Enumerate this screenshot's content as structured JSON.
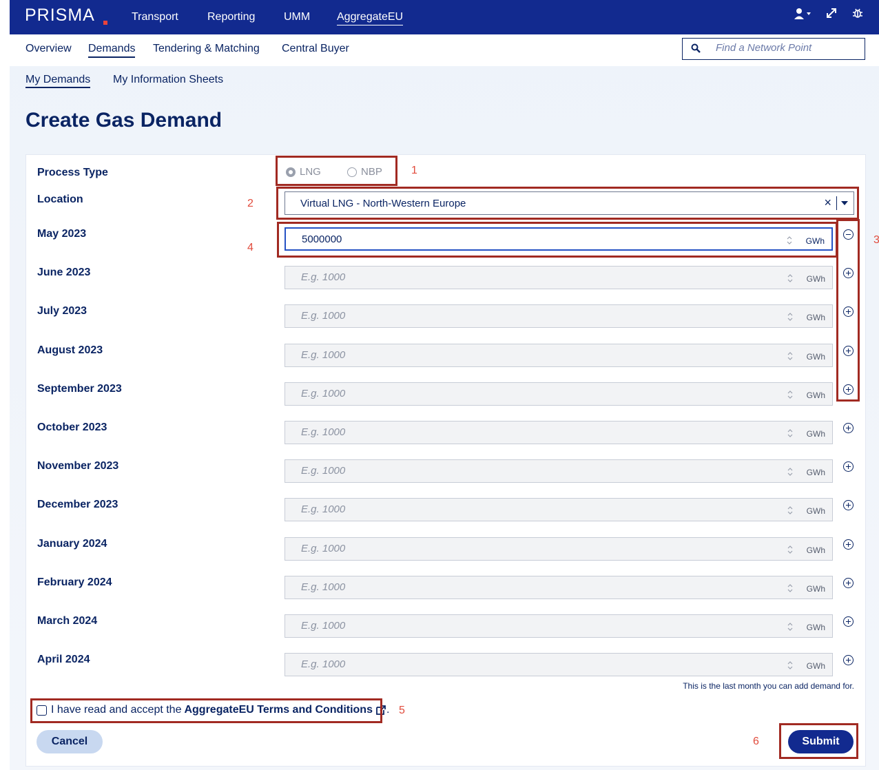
{
  "topbar": {
    "logo": "PRISMA",
    "nav": [
      "Transport",
      "Reporting",
      "UMM",
      "AggregateEU"
    ],
    "active": "AggregateEU"
  },
  "subnav": {
    "items": [
      "Overview",
      "Demands",
      "Tendering & Matching",
      "Central Buyer"
    ],
    "active": "Demands",
    "search_placeholder": "Find a Network Point"
  },
  "tabs": [
    "My Demands",
    "My Information Sheets"
  ],
  "page_title": "Create Gas Demand",
  "form": {
    "process_type_label": "Process Type",
    "process_options": [
      "LNG",
      "NBP"
    ],
    "process_selected": "LNG",
    "location_label": "Location",
    "location_value": "Virtual LNG - North-Western Europe",
    "unit": "GWh",
    "placeholder": "E.g. 1000",
    "months": [
      {
        "label": "May 2023",
        "value": "5000000"
      },
      {
        "label": "June 2023",
        "value": ""
      },
      {
        "label": "July 2023",
        "value": ""
      },
      {
        "label": "August 2023",
        "value": ""
      },
      {
        "label": "September 2023",
        "value": ""
      },
      {
        "label": "October 2023",
        "value": ""
      },
      {
        "label": "November 2023",
        "value": ""
      },
      {
        "label": "December 2023",
        "value": ""
      },
      {
        "label": "January 2024",
        "value": ""
      },
      {
        "label": "February 2024",
        "value": ""
      },
      {
        "label": "March 2024",
        "value": ""
      },
      {
        "label": "April 2024",
        "value": ""
      }
    ],
    "last_month_note": "This is the last month you can add demand for.",
    "terms_prefix": "I have read and accept the",
    "terms_link": "AggregateEU Terms and Conditions",
    "terms_suffix": ".",
    "cancel_label": "Cancel",
    "submit_label": "Submit"
  },
  "annotations": [
    "1",
    "2",
    "3",
    "4",
    "5",
    "6"
  ],
  "colors": {
    "brand": "#122a8f",
    "text": "#0a2463",
    "annotation": "#a12a22",
    "annotation_number": "#e14b3c"
  }
}
